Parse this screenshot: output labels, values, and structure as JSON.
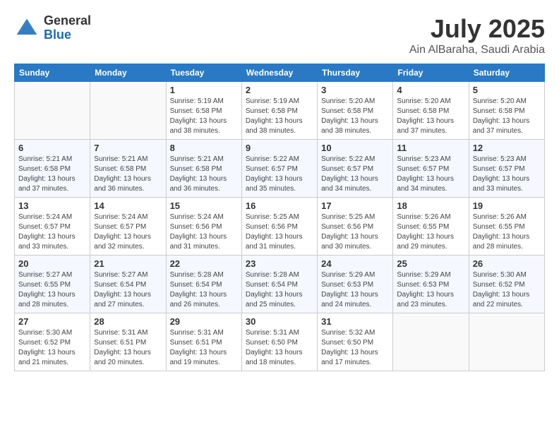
{
  "header": {
    "logo_general": "General",
    "logo_blue": "Blue",
    "month": "July 2025",
    "location": "Ain AlBaraha, Saudi Arabia"
  },
  "weekdays": [
    "Sunday",
    "Monday",
    "Tuesday",
    "Wednesday",
    "Thursday",
    "Friday",
    "Saturday"
  ],
  "weeks": [
    [
      {
        "day": "",
        "sunrise": "",
        "sunset": "",
        "daylight": ""
      },
      {
        "day": "",
        "sunrise": "",
        "sunset": "",
        "daylight": ""
      },
      {
        "day": "1",
        "sunrise": "Sunrise: 5:19 AM",
        "sunset": "Sunset: 6:58 PM",
        "daylight": "Daylight: 13 hours and 38 minutes."
      },
      {
        "day": "2",
        "sunrise": "Sunrise: 5:19 AM",
        "sunset": "Sunset: 6:58 PM",
        "daylight": "Daylight: 13 hours and 38 minutes."
      },
      {
        "day": "3",
        "sunrise": "Sunrise: 5:20 AM",
        "sunset": "Sunset: 6:58 PM",
        "daylight": "Daylight: 13 hours and 38 minutes."
      },
      {
        "day": "4",
        "sunrise": "Sunrise: 5:20 AM",
        "sunset": "Sunset: 6:58 PM",
        "daylight": "Daylight: 13 hours and 37 minutes."
      },
      {
        "day": "5",
        "sunrise": "Sunrise: 5:20 AM",
        "sunset": "Sunset: 6:58 PM",
        "daylight": "Daylight: 13 hours and 37 minutes."
      }
    ],
    [
      {
        "day": "6",
        "sunrise": "Sunrise: 5:21 AM",
        "sunset": "Sunset: 6:58 PM",
        "daylight": "Daylight: 13 hours and 37 minutes."
      },
      {
        "day": "7",
        "sunrise": "Sunrise: 5:21 AM",
        "sunset": "Sunset: 6:58 PM",
        "daylight": "Daylight: 13 hours and 36 minutes."
      },
      {
        "day": "8",
        "sunrise": "Sunrise: 5:21 AM",
        "sunset": "Sunset: 6:58 PM",
        "daylight": "Daylight: 13 hours and 36 minutes."
      },
      {
        "day": "9",
        "sunrise": "Sunrise: 5:22 AM",
        "sunset": "Sunset: 6:57 PM",
        "daylight": "Daylight: 13 hours and 35 minutes."
      },
      {
        "day": "10",
        "sunrise": "Sunrise: 5:22 AM",
        "sunset": "Sunset: 6:57 PM",
        "daylight": "Daylight: 13 hours and 34 minutes."
      },
      {
        "day": "11",
        "sunrise": "Sunrise: 5:23 AM",
        "sunset": "Sunset: 6:57 PM",
        "daylight": "Daylight: 13 hours and 34 minutes."
      },
      {
        "day": "12",
        "sunrise": "Sunrise: 5:23 AM",
        "sunset": "Sunset: 6:57 PM",
        "daylight": "Daylight: 13 hours and 33 minutes."
      }
    ],
    [
      {
        "day": "13",
        "sunrise": "Sunrise: 5:24 AM",
        "sunset": "Sunset: 6:57 PM",
        "daylight": "Daylight: 13 hours and 33 minutes."
      },
      {
        "day": "14",
        "sunrise": "Sunrise: 5:24 AM",
        "sunset": "Sunset: 6:57 PM",
        "daylight": "Daylight: 13 hours and 32 minutes."
      },
      {
        "day": "15",
        "sunrise": "Sunrise: 5:24 AM",
        "sunset": "Sunset: 6:56 PM",
        "daylight": "Daylight: 13 hours and 31 minutes."
      },
      {
        "day": "16",
        "sunrise": "Sunrise: 5:25 AM",
        "sunset": "Sunset: 6:56 PM",
        "daylight": "Daylight: 13 hours and 31 minutes."
      },
      {
        "day": "17",
        "sunrise": "Sunrise: 5:25 AM",
        "sunset": "Sunset: 6:56 PM",
        "daylight": "Daylight: 13 hours and 30 minutes."
      },
      {
        "day": "18",
        "sunrise": "Sunrise: 5:26 AM",
        "sunset": "Sunset: 6:55 PM",
        "daylight": "Daylight: 13 hours and 29 minutes."
      },
      {
        "day": "19",
        "sunrise": "Sunrise: 5:26 AM",
        "sunset": "Sunset: 6:55 PM",
        "daylight": "Daylight: 13 hours and 28 minutes."
      }
    ],
    [
      {
        "day": "20",
        "sunrise": "Sunrise: 5:27 AM",
        "sunset": "Sunset: 6:55 PM",
        "daylight": "Daylight: 13 hours and 28 minutes."
      },
      {
        "day": "21",
        "sunrise": "Sunrise: 5:27 AM",
        "sunset": "Sunset: 6:54 PM",
        "daylight": "Daylight: 13 hours and 27 minutes."
      },
      {
        "day": "22",
        "sunrise": "Sunrise: 5:28 AM",
        "sunset": "Sunset: 6:54 PM",
        "daylight": "Daylight: 13 hours and 26 minutes."
      },
      {
        "day": "23",
        "sunrise": "Sunrise: 5:28 AM",
        "sunset": "Sunset: 6:54 PM",
        "daylight": "Daylight: 13 hours and 25 minutes."
      },
      {
        "day": "24",
        "sunrise": "Sunrise: 5:29 AM",
        "sunset": "Sunset: 6:53 PM",
        "daylight": "Daylight: 13 hours and 24 minutes."
      },
      {
        "day": "25",
        "sunrise": "Sunrise: 5:29 AM",
        "sunset": "Sunset: 6:53 PM",
        "daylight": "Daylight: 13 hours and 23 minutes."
      },
      {
        "day": "26",
        "sunrise": "Sunrise: 5:30 AM",
        "sunset": "Sunset: 6:52 PM",
        "daylight": "Daylight: 13 hours and 22 minutes."
      }
    ],
    [
      {
        "day": "27",
        "sunrise": "Sunrise: 5:30 AM",
        "sunset": "Sunset: 6:52 PM",
        "daylight": "Daylight: 13 hours and 21 minutes."
      },
      {
        "day": "28",
        "sunrise": "Sunrise: 5:31 AM",
        "sunset": "Sunset: 6:51 PM",
        "daylight": "Daylight: 13 hours and 20 minutes."
      },
      {
        "day": "29",
        "sunrise": "Sunrise: 5:31 AM",
        "sunset": "Sunset: 6:51 PM",
        "daylight": "Daylight: 13 hours and 19 minutes."
      },
      {
        "day": "30",
        "sunrise": "Sunrise: 5:31 AM",
        "sunset": "Sunset: 6:50 PM",
        "daylight": "Daylight: 13 hours and 18 minutes."
      },
      {
        "day": "31",
        "sunrise": "Sunrise: 5:32 AM",
        "sunset": "Sunset: 6:50 PM",
        "daylight": "Daylight: 13 hours and 17 minutes."
      },
      {
        "day": "",
        "sunrise": "",
        "sunset": "",
        "daylight": ""
      },
      {
        "day": "",
        "sunrise": "",
        "sunset": "",
        "daylight": ""
      }
    ]
  ]
}
